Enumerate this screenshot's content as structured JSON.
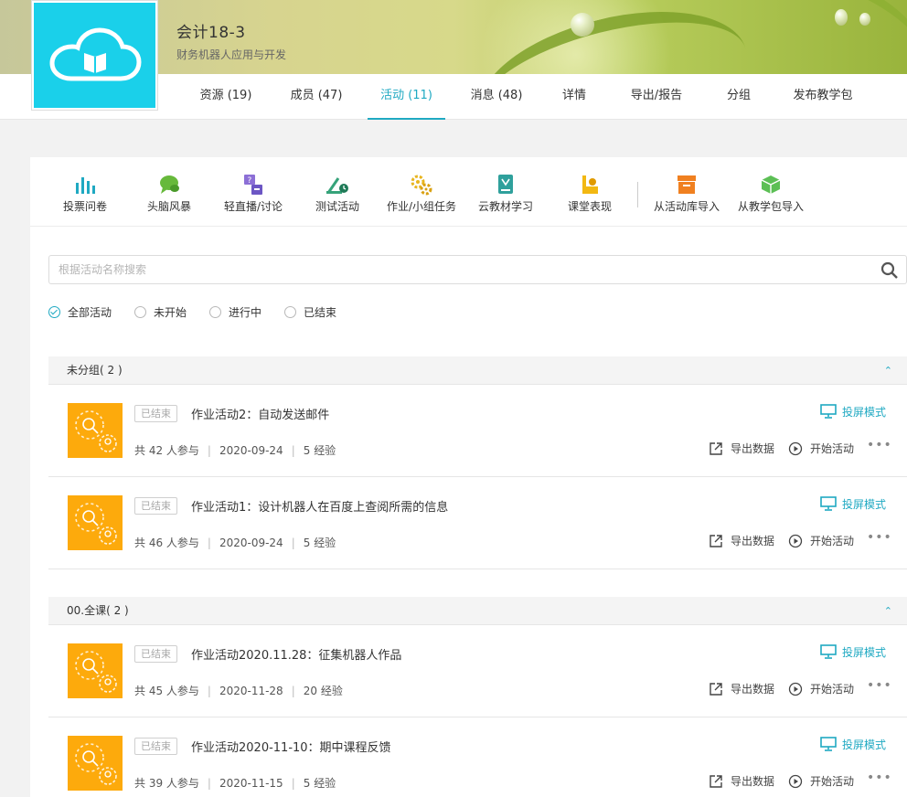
{
  "course": {
    "title": "会计18-3",
    "subtitle": "财务机器人应用与开发"
  },
  "nav": [
    {
      "label": "资源 (19)"
    },
    {
      "label": "成员 (47)"
    },
    {
      "label": "活动 (11)"
    },
    {
      "label": "消息 (48)"
    },
    {
      "label": "详情"
    },
    {
      "label": "导出/报告"
    },
    {
      "label": "分组"
    },
    {
      "label": "发布教学包"
    }
  ],
  "nav_active": "活动 (11)",
  "tools": [
    {
      "label": "投票问卷",
      "icon": "bar-chart-icon",
      "color": "#1fa9c2"
    },
    {
      "label": "头脑风暴",
      "icon": "chat-bubbles-icon",
      "color": "#67b93b"
    },
    {
      "label": "轻直播/讨论",
      "icon": "live-discussion-icon",
      "color": "#8c6fd6"
    },
    {
      "label": "测试活动",
      "icon": "test-clock-icon",
      "color": "#36a37a"
    },
    {
      "label": "作业/小组任务",
      "icon": "gears-icon",
      "color": "#e8b51f"
    },
    {
      "label": "云教材学习",
      "icon": "textbook-icon",
      "color": "#2fa09c"
    },
    {
      "label": "课堂表现",
      "icon": "performance-icon",
      "color": "#f2b812"
    },
    {
      "label": "从活动库导入",
      "icon": "archive-box-icon",
      "color": "#f08020"
    },
    {
      "label": "从教学包导入",
      "icon": "package-cube-icon",
      "color": "#5cbf55"
    }
  ],
  "search": {
    "placeholder": "根据活动名称搜索"
  },
  "filters": [
    {
      "label": "全部活动",
      "checked": true
    },
    {
      "label": "未开始",
      "checked": false
    },
    {
      "label": "进行中",
      "checked": false
    },
    {
      "label": "已结束",
      "checked": false
    }
  ],
  "groups": [
    {
      "name": "未分组( 2 )",
      "activities": [
        {
          "status": "已结束",
          "title": "作业活动2：自动发送邮件",
          "participants": "共 42 人参与",
          "date": "2020-09-24",
          "exp": "5 经验"
        },
        {
          "status": "已结束",
          "title": "作业活动1：设计机器人在百度上查阅所需的信息",
          "participants": "共 46 人参与",
          "date": "2020-09-24",
          "exp": "5 经验"
        }
      ]
    },
    {
      "name": "00.全课( 2 )",
      "activities": [
        {
          "status": "已结束",
          "title": "作业活动2020.11.28：征集机器人作品",
          "participants": "共 45 人参与",
          "date": "2020-11-28",
          "exp": "20 经验"
        },
        {
          "status": "已结束",
          "title": "作业活动2020-11-10：期中课程反馈",
          "participants": "共 39 人参与",
          "date": "2020-11-15",
          "exp": "5 经验"
        }
      ]
    }
  ],
  "actions": {
    "projection": "投屏模式",
    "export": "导出数据",
    "start": "开始活动",
    "more": "•••"
  },
  "colors": {
    "accent": "#1fa9c2",
    "thumb": "#fdaa0c",
    "logo_bg": "#1ad0ea"
  }
}
